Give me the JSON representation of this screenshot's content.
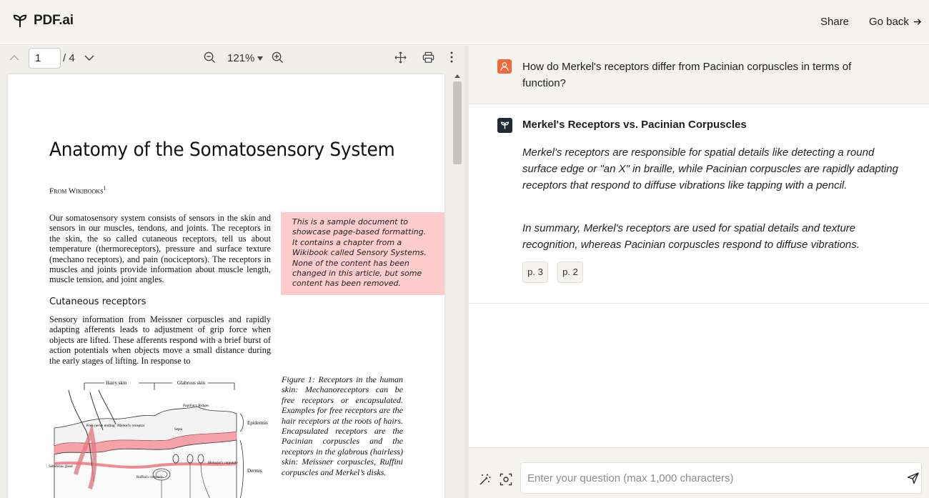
{
  "app": {
    "brand": "PDF.ai",
    "share_label": "Share",
    "go_back_label": "Go back"
  },
  "viewer": {
    "page_current": "1",
    "page_total": "/ 4",
    "zoom": "121%"
  },
  "document": {
    "title": "Anatomy of the Somatosensory System",
    "from": "From Wikibooks",
    "from_footnote": "1",
    "para1": "Our somatosensory system consists of sensors in the skin and sensors in our muscles, tendons, and joints. The receptors in the skin, the so called cutaneous receptors, tell us about temperature (thermoreceptors), pressure and surface texture (mechano receptors), and pain (nociceptors). The receptors in muscles and joints provide information about muscle length, muscle tension, and joint angles.",
    "note": "This is a sample document to showcase page-based formatting. It contains a chapter from a Wikibook called Sensory Systems. None of the content has been changed in this article, but some content has been removed.",
    "section_heading": "Cutaneous receptors",
    "para2": "Sensory information from Meissner corpuscles and rapidly adapting afferents leads to adjustment of grip force when objects are lifted. These afferents respond with a brief burst of action potentials when objects move a small distance during the early stages of lifting. In response to",
    "figure_caption": "Figure 1: Receptors in the human skin: Mechanoreceptors can be free receptors or encapsulated. Examples for free receptors are the hair receptors at the roots of hairs. Encapsulated receptors are the Pacinian corpuscles and the receptors in the glabrous (hairless) skin: Meissner corpuscles, Ruffini corpuscles and Merkel’s disks.",
    "figure_labels": {
      "hairy_skin": "Hairy skin",
      "glabrous_skin": "Glabrous skin",
      "papillary_ridges": "Papillary Ridges",
      "septa": "Septa",
      "free_nerve": "Free nerve ending",
      "merkels": "Merkel's receptor",
      "epidermis": "Epidermis",
      "dermis": "Dermis",
      "sebaceous": "Sebaceous gland",
      "meissner": "Meissner's corpuscle",
      "ruffini": "Ruffini's corpuscle"
    }
  },
  "chat": {
    "question": "How do Merkel's receptors differ from Pacinian corpuscles in terms of function?",
    "answer_title": "Merkel's Receptors vs. Pacinian Corpuscles",
    "answer_p1": "Merkel's receptors are responsible for spatial details like detecting a round surface edge or \"an X\" in braille, while Pacinian corpuscles are rapidly adapting receptors that respond to diffuse vibrations like tapping with a pencil.",
    "answer_p2": "In summary, Merkel's receptors are used for spatial details and texture recognition, whereas Pacinian corpuscles respond to diffuse vibrations.",
    "citations": [
      "p. 3",
      "p. 2"
    ],
    "input_placeholder": "Enter your question (max 1,000 characters)"
  },
  "colors": {
    "user_avatar": "#ef6a3b",
    "ai_avatar": "#1d2b33",
    "note_bg": "#ffcccc",
    "skin_pink": "#f5a3a8"
  },
  "icons": [
    "logo-icon",
    "arrow-right-icon",
    "chevron-up-icon",
    "chevron-down-icon",
    "zoom-out-icon",
    "zoom-in-icon",
    "move-icon",
    "print-icon",
    "more-vertical-icon",
    "user-icon",
    "ai-logo-icon",
    "magic-wand-icon",
    "scan-icon",
    "send-icon"
  ]
}
